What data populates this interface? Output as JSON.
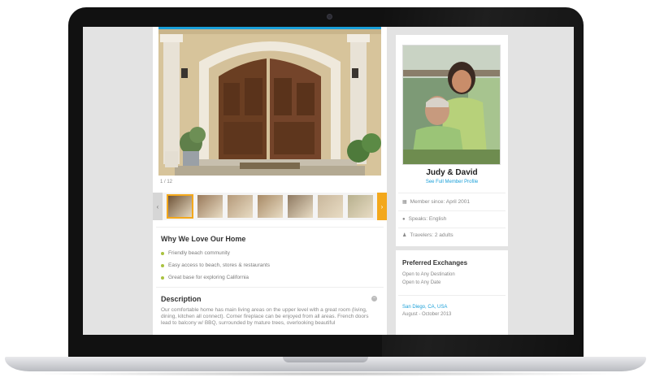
{
  "gallery": {
    "counter": "1 / 12",
    "prev_icon": "chevron-left-icon",
    "next_icon": "chevron-right-icon",
    "prev_glyph": "‹",
    "next_glyph": "›",
    "thumbnails": [
      {
        "label": "thumb-1",
        "color": "#6b4f33",
        "selected": true
      },
      {
        "label": "thumb-2",
        "color": "#9a7a5b",
        "selected": false
      },
      {
        "label": "thumb-3",
        "color": "#b59a7a",
        "selected": false
      },
      {
        "label": "thumb-4",
        "color": "#a88a66",
        "selected": false
      },
      {
        "label": "thumb-5",
        "color": "#8f7a62",
        "selected": false
      },
      {
        "label": "thumb-6",
        "color": "#c9b79c",
        "selected": false
      },
      {
        "label": "thumb-7",
        "color": "#b7b08e",
        "selected": false
      }
    ]
  },
  "why": {
    "title": "Why We Love Our Home",
    "items": [
      "Friendly beach community",
      "Easy access to beach, stores & restaurants",
      "Great base for exploring California"
    ]
  },
  "description": {
    "title": "Description",
    "text": "Our comfortable home has main living areas on the upper level with a great room (living, dining, kitchen all connect). Corner fireplace can be enjoyed from all areas. French doors lead to balcony w/ BBQ, surrounded by mature trees, overlooking beautiful",
    "toggle_icon": "minus-icon"
  },
  "profile": {
    "name": "Judy & David",
    "link": "See Full Member Profile",
    "member_since": "Member since: April 2001",
    "speaks": "Speaks: English",
    "travelers": "Travelers: 2 adults"
  },
  "preferred": {
    "title": "Preferred Exchanges",
    "lines": [
      "Open to Any Destination",
      "Open to Any Date"
    ],
    "destination": "San Diego, CA, USA",
    "dates": "August - October 2013"
  },
  "colors": {
    "accent": "#1a9fd8",
    "highlight": "#f3a81c",
    "bullet": "#a9c23f"
  }
}
